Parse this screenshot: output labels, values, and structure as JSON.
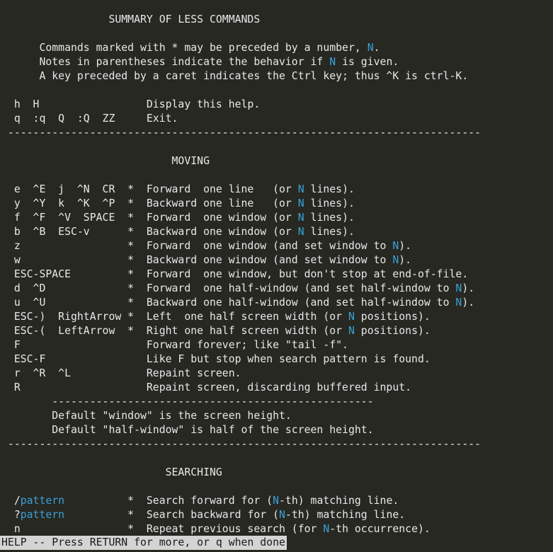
{
  "help_lines": [
    {
      "segs": [
        {
          "t": "                 SUMMARY OF LESS COMMANDS"
        }
      ]
    },
    {
      "segs": []
    },
    {
      "segs": [
        {
          "t": "      Commands marked with * may be preceded by a number, "
        },
        {
          "t": "N",
          "hl": true
        },
        {
          "t": "."
        }
      ]
    },
    {
      "segs": [
        {
          "t": "      Notes in parentheses indicate the behavior if "
        },
        {
          "t": "N",
          "hl": true
        },
        {
          "t": " is given."
        }
      ]
    },
    {
      "segs": [
        {
          "t": "      A key preceded by a caret indicates the Ctrl key; thus ^K is ctrl-K."
        }
      ]
    },
    {
      "segs": []
    },
    {
      "segs": [
        {
          "t": "  h  H                 Display this help."
        }
      ]
    },
    {
      "segs": [
        {
          "t": "  q  :q  Q  :Q  ZZ     Exit."
        }
      ]
    },
    {
      "segs": [
        {
          "t": " ---------------------------------------------------------------------------"
        }
      ]
    },
    {
      "segs": []
    },
    {
      "segs": [
        {
          "t": "                           MOVING"
        }
      ]
    },
    {
      "segs": []
    },
    {
      "segs": [
        {
          "t": "  e  ^E  j  ^N  CR  *  Forward  one line   (or "
        },
        {
          "t": "N",
          "hl": true
        },
        {
          "t": " lines)."
        }
      ]
    },
    {
      "segs": [
        {
          "t": "  y  ^Y  k  ^K  ^P  *  Backward one line   (or "
        },
        {
          "t": "N",
          "hl": true
        },
        {
          "t": " lines)."
        }
      ]
    },
    {
      "segs": [
        {
          "t": "  f  ^F  ^V  SPACE  *  Forward  one window (or "
        },
        {
          "t": "N",
          "hl": true
        },
        {
          "t": " lines)."
        }
      ]
    },
    {
      "segs": [
        {
          "t": "  b  ^B  ESC-v      *  Backward one window (or "
        },
        {
          "t": "N",
          "hl": true
        },
        {
          "t": " lines)."
        }
      ]
    },
    {
      "segs": [
        {
          "t": "  z                 *  Forward  one window (and set window to "
        },
        {
          "t": "N",
          "hl": true
        },
        {
          "t": ")."
        }
      ]
    },
    {
      "segs": [
        {
          "t": "  w                 *  Backward one window (and set window to "
        },
        {
          "t": "N",
          "hl": true
        },
        {
          "t": ")."
        }
      ]
    },
    {
      "segs": [
        {
          "t": "  ESC-SPACE         *  Forward  one window, but don't stop at end-of-file."
        }
      ]
    },
    {
      "segs": [
        {
          "t": "  d  ^D             *  Forward  one half-window (and set half-window to "
        },
        {
          "t": "N",
          "hl": true
        },
        {
          "t": ")."
        }
      ]
    },
    {
      "segs": [
        {
          "t": "  u  ^U             *  Backward one half-window (and set half-window to "
        },
        {
          "t": "N",
          "hl": true
        },
        {
          "t": ")."
        }
      ]
    },
    {
      "segs": [
        {
          "t": "  ESC-)  RightArrow *  Left  one half screen width (or "
        },
        {
          "t": "N",
          "hl": true
        },
        {
          "t": " positions)."
        }
      ]
    },
    {
      "segs": [
        {
          "t": "  ESC-(  LeftArrow  *  Right one half screen width (or "
        },
        {
          "t": "N",
          "hl": true
        },
        {
          "t": " positions)."
        }
      ]
    },
    {
      "segs": [
        {
          "t": "  F                    Forward forever; like \"tail -f\"."
        }
      ]
    },
    {
      "segs": [
        {
          "t": "  ESC-F                Like F but stop when search pattern is found."
        }
      ]
    },
    {
      "segs": [
        {
          "t": "  r  ^R  ^L            Repaint screen."
        }
      ]
    },
    {
      "segs": [
        {
          "t": "  R                    Repaint screen, discarding buffered input."
        }
      ]
    },
    {
      "segs": [
        {
          "t": "        ---------------------------------------------------"
        }
      ]
    },
    {
      "segs": [
        {
          "t": "        Default \"window\" is the screen height."
        }
      ]
    },
    {
      "segs": [
        {
          "t": "        Default \"half-window\" is half of the screen height."
        }
      ]
    },
    {
      "segs": [
        {
          "t": " ---------------------------------------------------------------------------"
        }
      ]
    },
    {
      "segs": []
    },
    {
      "segs": [
        {
          "t": "                          SEARCHING"
        }
      ]
    },
    {
      "segs": []
    },
    {
      "segs": [
        {
          "t": "  /"
        },
        {
          "t": "pattern",
          "hl": true
        },
        {
          "t": "          *  Search forward for ("
        },
        {
          "t": "N",
          "hl": true
        },
        {
          "t": "-th) matching line."
        }
      ]
    },
    {
      "segs": [
        {
          "t": "  ?"
        },
        {
          "t": "pattern",
          "hl": true
        },
        {
          "t": "          *  Search backward for ("
        },
        {
          "t": "N",
          "hl": true
        },
        {
          "t": "-th) matching line."
        }
      ]
    },
    {
      "segs": [
        {
          "t": "  n                 *  Repeat previous search (for "
        },
        {
          "t": "N",
          "hl": true
        },
        {
          "t": "-th occurrence)."
        }
      ]
    }
  ],
  "status_prompt": "HELP -- Press RETURN for more, or q when done",
  "colors": {
    "background": "#272822",
    "text": "#e8e8e8",
    "highlight": "#3aa0d6",
    "status_bar_bg": "#d4d4d4",
    "status_bar_text": "#1a1a1a"
  }
}
